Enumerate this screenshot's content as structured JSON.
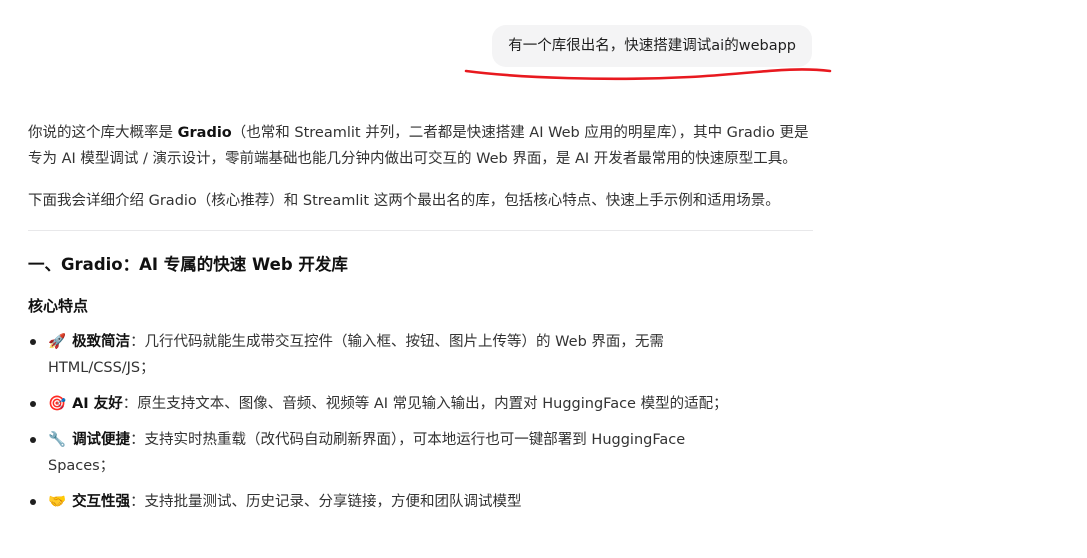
{
  "user_message": {
    "text": "有一个库很出名，快速搭建调试ai的webapp"
  },
  "answer": {
    "p1": {
      "before": "你说的这个库大概率是 ",
      "bold": "Gradio",
      "after": "（也常和 Streamlit 并列，二者都是快速搭建 AI Web 应用的明星库），其中 Gradio 更是专为 AI 模型调试 / 演示设计，零前端基础也能几分钟内做出可交互的 Web 界面，是 AI 开发者最常用的快速原型工具。"
    },
    "p2": "下面我会详细介绍 Gradio（核心推荐）和 Streamlit 这两个最出名的库，包括核心特点、快速上手示例和适用场景。",
    "section_title": "一、Gradio：AI 专属的快速 Web 开发库",
    "subsection_title": "核心特点",
    "features": [
      {
        "emoji": "🚀",
        "title": "极致简洁",
        "text": "：几行代码就能生成带交互控件（输入框、按钮、图片上传等）的 Web 界面，无需 HTML/CSS/JS；"
      },
      {
        "emoji": "🎯",
        "title": "AI 友好",
        "text": "：原生支持文本、图像、音频、视频等 AI 常见输入输出，内置对 HuggingFace 模型的适配；"
      },
      {
        "emoji": "🔧",
        "title": "调试便捷",
        "text": "：支持实时热重载（改代码自动刷新界面），可本地运行也可一键部署到 HuggingFace Spaces；"
      },
      {
        "emoji": "🤝",
        "title": "交互性强",
        "text": "：支持批量测试、历史记录、分享链接，方便和团队调试模型"
      }
    ]
  },
  "colors": {
    "bubble_bg": "#f4f4f5",
    "annotation": "#e8191f",
    "text": "#333333"
  }
}
